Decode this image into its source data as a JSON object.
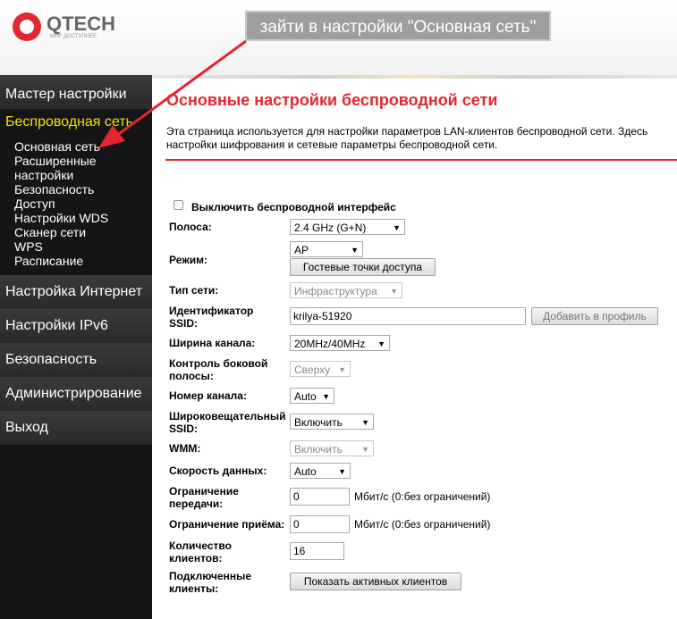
{
  "logo": {
    "name": "QTECH",
    "tagline": "МИР ДОСТУПНЕЕ"
  },
  "callout": "зайти в настройки \"Основная сеть\"",
  "sidebar": {
    "wizard": "Мастер настройки",
    "wireless": "Беспроводная сеть",
    "sub": [
      "Основная сеть",
      "Расширенные",
      "настройки",
      "Безопасность",
      "Доступ",
      "Настройки WDS",
      "Сканер сети",
      "WPS",
      "Расписание"
    ],
    "internet": "Настройка Интернет",
    "ipv6": "Настройки IPv6",
    "security": "Безопасность",
    "admin": "Администрирование",
    "logout": "Выход"
  },
  "page": {
    "title": "Основные настройки беспроводной сети",
    "desc1": "Эта страница используется для настройки параметров LAN-клиентов беспроводной сети. Здесь",
    "desc2": "настройки шифрования и сетевые параметры беспроводной сети."
  },
  "form": {
    "disable_label": "Выключить беспроводной интерфейс",
    "band_label": "Полоса:",
    "band_value": "2.4 GHz (G+N)",
    "mode_label": "Режим:",
    "mode_value": "AP",
    "guest_button": "Гостевые точки доступа",
    "nettype_label": "Тип сети:",
    "nettype_value": "Инфраструктура",
    "ssid_label1": "Идентификатор",
    "ssid_label2": "SSID:",
    "ssid_value": "krilya-51920",
    "add_profile_button": "Добавить в профиль",
    "width_label": "Ширина канала:",
    "width_value": "20MHz/40MHz",
    "sideband_label1": "Контроль боковой",
    "sideband_label2": "полосы:",
    "sideband_value": "Сверху",
    "channel_label": "Номер канала:",
    "channel_value": "Auto",
    "broadcast_label1": "Широковещательный",
    "broadcast_label2": "SSID:",
    "broadcast_value": "Включить",
    "wmm_label": "WMM:",
    "wmm_value": "Включить",
    "rate_label": "Скорость данных:",
    "rate_value": "Auto",
    "tx_label1": "Ограничение",
    "tx_label2": "передачи:",
    "tx_value": "0",
    "tx_unit": "Мбит/с (0:без ограничений)",
    "rx_label": "Ограничение приёма:",
    "rx_value": "0",
    "rx_unit": "Мбит/с (0:без ограничений)",
    "clients_label1": "Количество",
    "clients_label2": "клиентов:",
    "clients_value": "16",
    "connected_label1": "Подключенные",
    "connected_label2": "клиенты:",
    "show_clients_button": "Показать активных клиентов"
  },
  "colors": {
    "accent": "#e3262f",
    "active_menu": "#f0e000",
    "sidebar_bg": "#151515"
  }
}
